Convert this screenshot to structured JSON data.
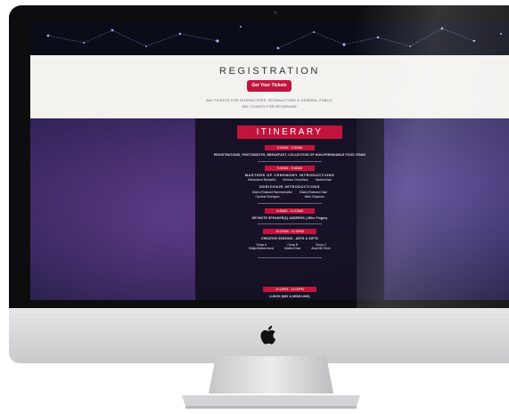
{
  "page": {
    "header": {
      "title": "REGISTRATION",
      "cta_button": "Get Your Tickets Now!",
      "note_1": "$60 TICKETS FOR INTERACTORS, ROTARACTORS & GENERAL PUBLIC",
      "note_2": "$50 TICKETS FOR ROTARIANS"
    },
    "itinerary": {
      "title": "ITINERARY",
      "blocks": [
        {
          "time": "9:00AM - 9:30AM",
          "lines": [
            "REGISTRATIONS, PHOTOBOOTH, BREAKFAST, COLLECTION OF NON-PERISHABLE FOOD ITEMS"
          ]
        },
        {
          "time": "9:30AM - 9:45AM",
          "heading": "MASTERS OF CEREMONY INTRODUCTIONS",
          "names": [
            "Mohammed Mohsaflin",
            "Murtuza Chowdhury",
            "Madha Khan"
          ],
          "heading2": "DDR/CHAIR INTRODUCTIONS",
          "names2": [
            "District Rotaract Representative",
            "District Rotaract Chair",
            "Carolina Rodriguez",
            "Mark Chapman"
          ]
        },
        {
          "time": "9:45AM - 10:15AM",
          "lines": [
            "KEYNOTE SPEAKER(S) ADDRESS | Mike Fingley"
          ]
        },
        {
          "time": "10:20AM - 11:15PM",
          "heading": "CREATIVE SESSION - ARTS & GIFTS",
          "groups": [
            {
              "label": "Group A",
              "leader": "Matija Markovinovic"
            },
            {
              "label": "Group B",
              "leader": "Madha Khan"
            },
            {
              "label": "Group C",
              "leader": "Ahad Mir Taher"
            }
          ]
        },
        {
          "time": "11:15PM - 12:00PM",
          "heading": "LUNCH (MIX & MINGLING)"
        }
      ]
    }
  },
  "colors": {
    "accent": "#c0143c",
    "panel": "#15111f",
    "header_bg": "#f4f2ef",
    "bezel": "#0d0d0f",
    "chin": "#d8d8da"
  },
  "icons": {
    "logo": "apple-logo-icon"
  }
}
